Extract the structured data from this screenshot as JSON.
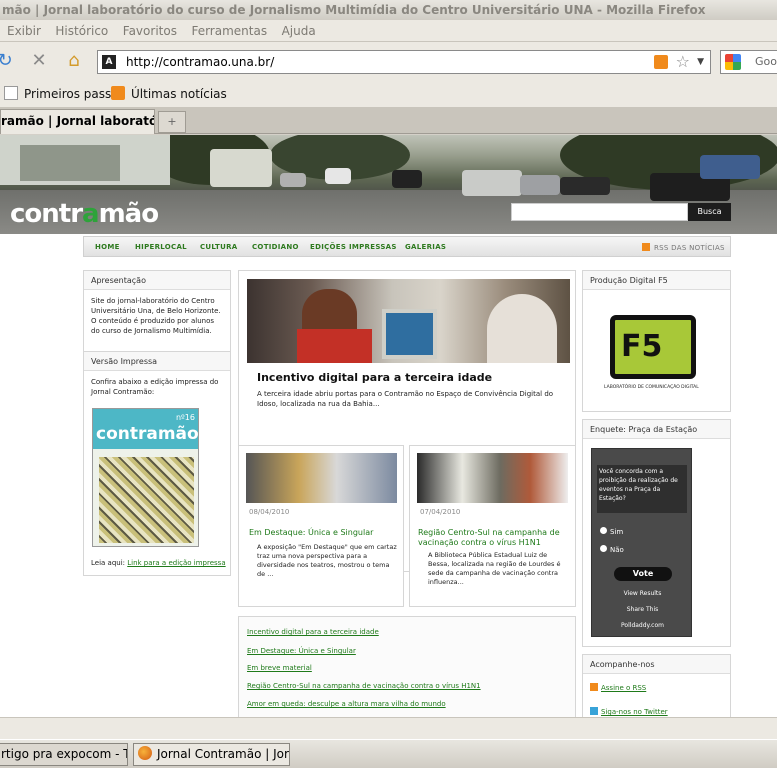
{
  "window": {
    "title": "mão | Jornal laboratório do curso de Jornalismo Multimídia do Centro Universitário UNA - Mozilla Firefox"
  },
  "menu": [
    "Exibir",
    "Histórico",
    "Favoritos",
    "Ferramentas",
    "Ajuda"
  ],
  "address": {
    "url": "http://contramao.una.br/",
    "favicon": "A"
  },
  "search": {
    "placeholder": "Goo"
  },
  "bookmarks": [
    "Primeiros passos",
    "Últimas notícias"
  ],
  "tabs": {
    "active": "ramão | Jornal laboratór...",
    "new": "+"
  },
  "site": {
    "logo_pre": "contr",
    "logo_a": "a",
    "logo_post": "mão",
    "search_button": "Busca",
    "nav": [
      "HOME",
      "HIPERLOCAL",
      "CULTURA",
      "COTIDIANO",
      "EDIÇÕES IMPRESSAS",
      "GALERIAS"
    ],
    "rss": "RSS DAS NOTÍCIAS",
    "apresentacao": {
      "title": "Apresentação",
      "text": "Site do jornal-laboratório do Centro Universitário Una, de Belo Horizonte. O conteúdo é produzido por alunos do curso de Jornalismo Multimídia."
    },
    "versao": {
      "title": "Versão Impressa",
      "text": "Confira abaixo a edição impressa do Jornal Contramão:",
      "cover_title": "contramão",
      "cover_num": "nº16",
      "link_prefix": "Leia aqui: ",
      "link": "Link para a edição impressa"
    },
    "featured": {
      "title": "Incentivo digital para a terceira idade",
      "text": "A terceira idade abriu portas para o Contramão no Espaço de Convivência Digital do Idoso, localizada na rua da Bahia..."
    },
    "post1": {
      "date": "08/04/2010",
      "title": "Em Destaque: Única e Singular",
      "text": "A exposição \"Em Destaque\" que em cartaz traz uma nova perspectiva para a diversidade nos teatros, mostrou o tema de ..."
    },
    "post2": {
      "date": "07/04/2010",
      "title": "Região Centro-Sul na campanha de vacinação contra o vírus H1N1",
      "text": "A Biblioteca Pública Estadual Luiz de Bessa, localizada na região de Lourdes é sede da campanha de vacinação contra influenza..."
    },
    "links": [
      "Incentivo digital para a terceira idade",
      "Em Destaque: Única e Singular",
      "Em breve material",
      "Região Centro-Sul na campanha de vacinação contra o vírus H1N1",
      "Amor em queda: desculpe a altura mara vilha do mundo"
    ],
    "f5": {
      "title": "Produção Digital F5",
      "logo": "F5",
      "caption": "LABORATÓRIO DE COMUNICAÇÃO DIGITAL"
    },
    "poll": {
      "title": "Enquete: Praça da Estação",
      "question": "Você concorda com a proibição da realização de eventos na Praça da Estação?",
      "yes": "Sim",
      "no": "Não",
      "vote": "Vote",
      "results": "View Results",
      "share": "Share This",
      "brand": "Polldaddy.com"
    },
    "follow": {
      "title": "Acompanhe-nos",
      "rss": "Assine o RSS",
      "twitter": "Siga-nos no Twitter"
    }
  },
  "taskbar": [
    "rtigo pra expocom - Tec...",
    "Jornal Contramão | Jorn..."
  ]
}
